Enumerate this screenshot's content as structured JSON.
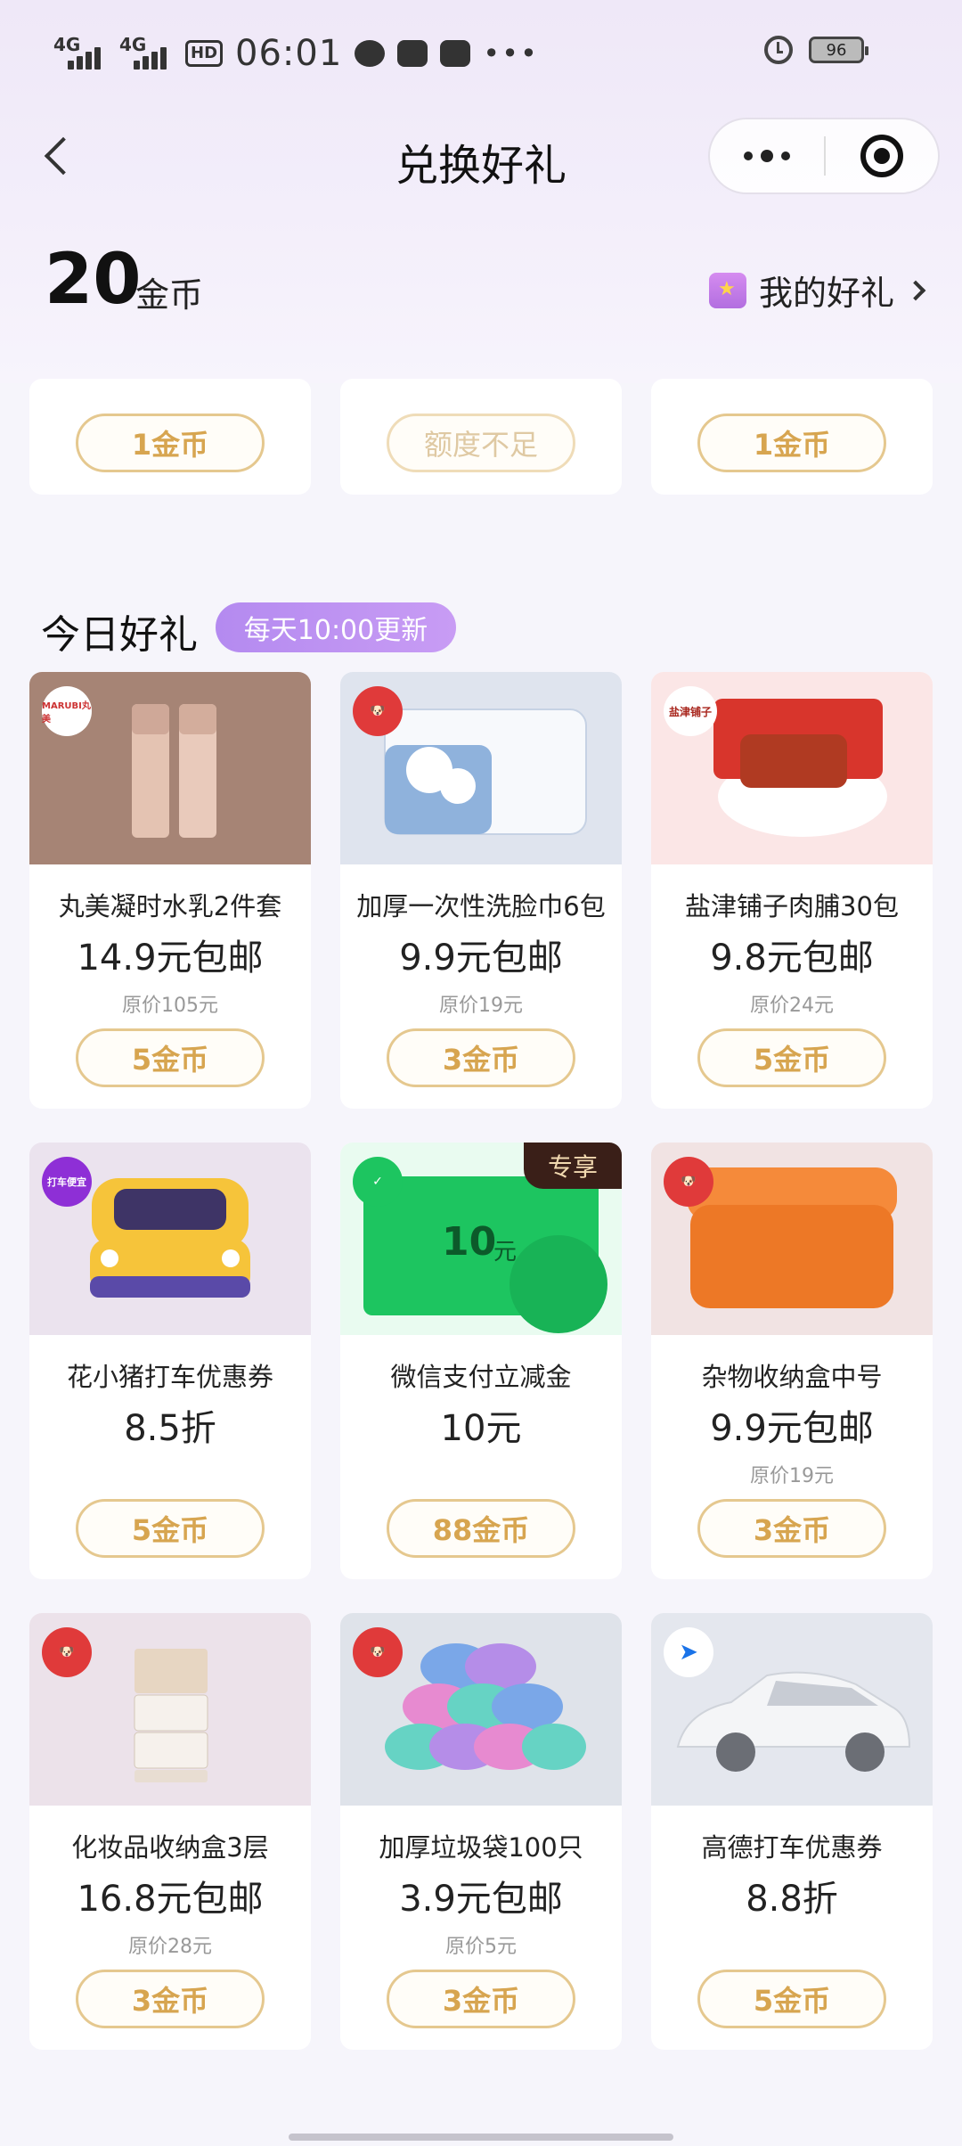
{
  "status_bar": {
    "net1": "4G",
    "net2": "4G",
    "hd": "HD",
    "time": "06:01",
    "battery": "96"
  },
  "nav": {
    "title": "兑换好礼"
  },
  "coins": {
    "amount": "20",
    "unit": "金币",
    "my_gifts_label": "我的好礼"
  },
  "top_row": [
    {
      "button": "1金币",
      "disabled": false
    },
    {
      "button": "额度不足",
      "disabled": true
    },
    {
      "button": "1金币",
      "disabled": false
    }
  ],
  "section": {
    "title": "今日好礼",
    "tag": "每天10:00更新"
  },
  "products": [
    {
      "name": "丸美凝时水乳2件套",
      "price": "14.9元包邮",
      "original": "原价105元",
      "button": "5金币",
      "brand_badge": "MARUBI丸美",
      "bg": "#a68475"
    },
    {
      "name": "加厚一次性洗脸巾6包",
      "price": "9.9元包邮",
      "original": "原价19元",
      "button": "3金币",
      "brand_badge": "jd-dog",
      "bg": "#dfe4ee"
    },
    {
      "name": "盐津铺子肉脯30包",
      "price": "9.8元包邮",
      "original": "原价24元",
      "button": "5金币",
      "brand_badge": "盐津铺子",
      "bg": "#fbe6e6"
    },
    {
      "name": "花小猪打车优惠券",
      "price": "8.5折",
      "original": "",
      "button": "5金币",
      "brand_badge": "打车便宜",
      "bg": "#ebe3ee"
    },
    {
      "name": "微信支付立减金",
      "price": "10元",
      "original": "",
      "button": "88金币",
      "brand_badge": "wechat-pay",
      "bg": "#e9fbf0",
      "tag": "专享",
      "voucher": "10",
      "voucher_unit": "元"
    },
    {
      "name": "杂物收纳盒中号",
      "price": "9.9元包邮",
      "original": "原价19元",
      "button": "3金币",
      "brand_badge": "jd-dog",
      "bg": "#f1e3e3"
    },
    {
      "name": "化妆品收纳盒3层",
      "price": "16.8元包邮",
      "original": "原价28元",
      "button": "3金币",
      "brand_badge": "jd-dog",
      "bg": "#ece2ea"
    },
    {
      "name": "加厚垃圾袋100只",
      "price": "3.9元包邮",
      "original": "原价5元",
      "button": "3金币",
      "brand_badge": "jd-dog",
      "bg": "#dfe3ea"
    },
    {
      "name": "高德打车优惠券",
      "price": "8.8折",
      "original": "",
      "button": "5金币",
      "brand_badge": "amap",
      "bg": "#e4e7ee"
    }
  ]
}
